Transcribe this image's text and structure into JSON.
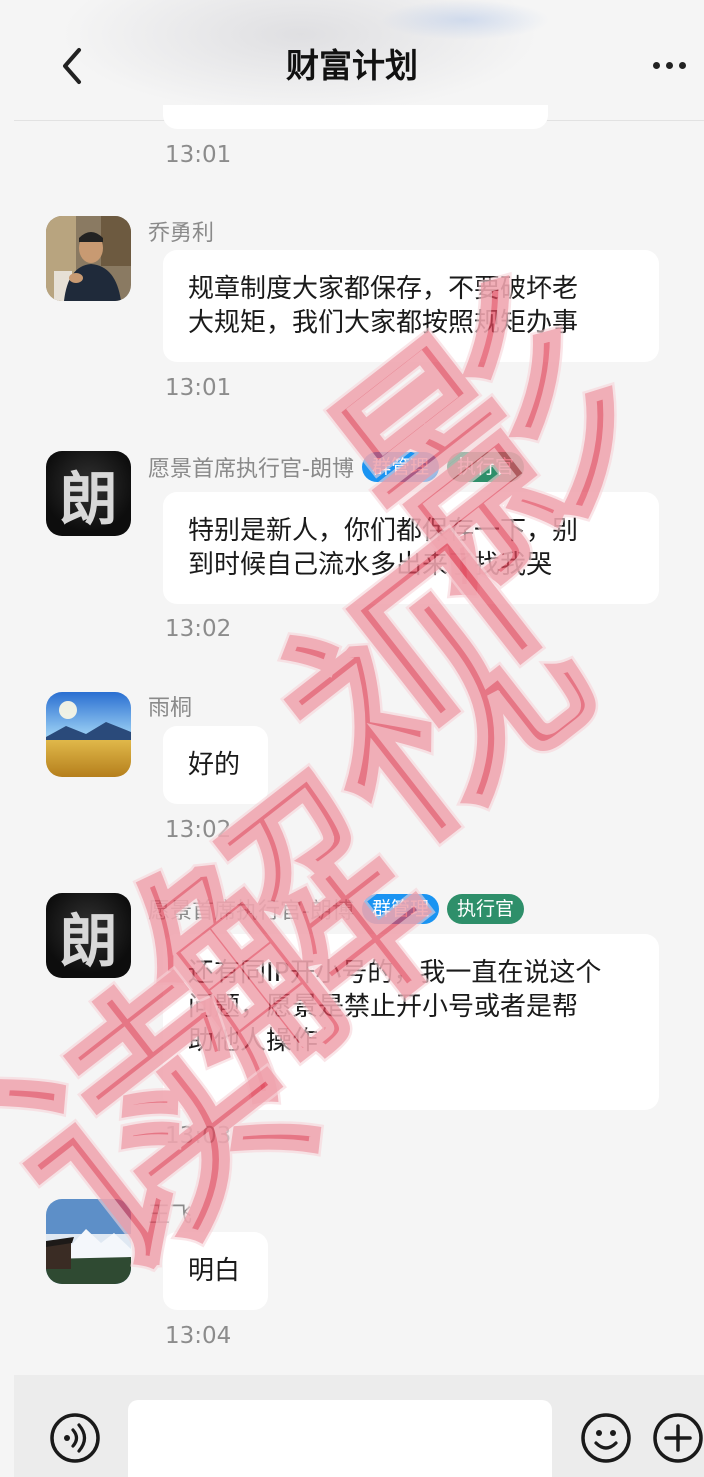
{
  "header": {
    "title": "财富计划"
  },
  "previous_message": {
    "time": "13:01"
  },
  "messages": [
    {
      "sender": "乔勇利",
      "badges": [],
      "text_lines": [
        "规章制度大家都保存，不要破坏老",
        "大规矩，我们大家都按照规矩办事"
      ],
      "time": "13:01"
    },
    {
      "sender": "愿景首席执行官-朗博",
      "badges": [
        "群管理",
        "执行官"
      ],
      "avatar_char": "朗",
      "text_lines": [
        "特别是新人，你们都保存一下，别",
        "到时候自己流水多出来了找我哭"
      ],
      "time": "13:02"
    },
    {
      "sender": "雨桐",
      "badges": [],
      "text_lines": [
        "好的"
      ],
      "time": "13:02"
    },
    {
      "sender": "愿景首席执行官-朗博",
      "badges": [
        "群管理",
        "执行官"
      ],
      "avatar_char": "朗",
      "text_lines": [
        "还有同IP开小号的，我一直在说这个",
        "问题，愿景是禁止开小号或者是帮",
        "助他人操作"
      ],
      "time": "13:03"
    },
    {
      "sender": "王飞",
      "badges": [],
      "text_lines": [
        "明白"
      ],
      "time": "13:04"
    }
  ],
  "watermark": {
    "text": "影视解读"
  },
  "icons": {
    "back": "chevron-left-icon",
    "more": "more-dots-icon",
    "voice": "voice-icon",
    "emoji": "emoji-icon",
    "add": "plus-circle-icon"
  },
  "colors": {
    "badge_admin": "#1a94f2",
    "badge_exec": "#2e8f6a",
    "watermark": "#e0455a"
  }
}
